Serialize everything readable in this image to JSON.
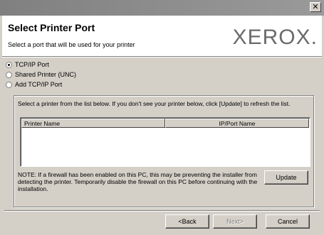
{
  "window": {
    "close_glyph": "✕"
  },
  "header": {
    "title": "Select Printer Port",
    "subtitle": "Select a port that will be used for your printer",
    "logo_text": "XEROX."
  },
  "ports": {
    "options": [
      {
        "label": "TCP/IP Port",
        "checked": true
      },
      {
        "label": "Shared Printer (UNC)",
        "checked": false
      },
      {
        "label": "Add TCP/IP Port",
        "checked": false
      }
    ]
  },
  "printer_list": {
    "description": "Select a printer from the list below. If you don't see your printer below, click [Update] to refresh the list.",
    "columns": [
      "Printer Name",
      "IP/Port Name"
    ],
    "rows": []
  },
  "note": "NOTE: If a firewall has been enabled on this PC, this may be preventing the installer from detecting the printer. Temporarily disable the firewall on this PC before continuing with the installation.",
  "buttons": {
    "update": "Update",
    "back": "<Back",
    "next": "Next>",
    "cancel": "Cancel"
  }
}
